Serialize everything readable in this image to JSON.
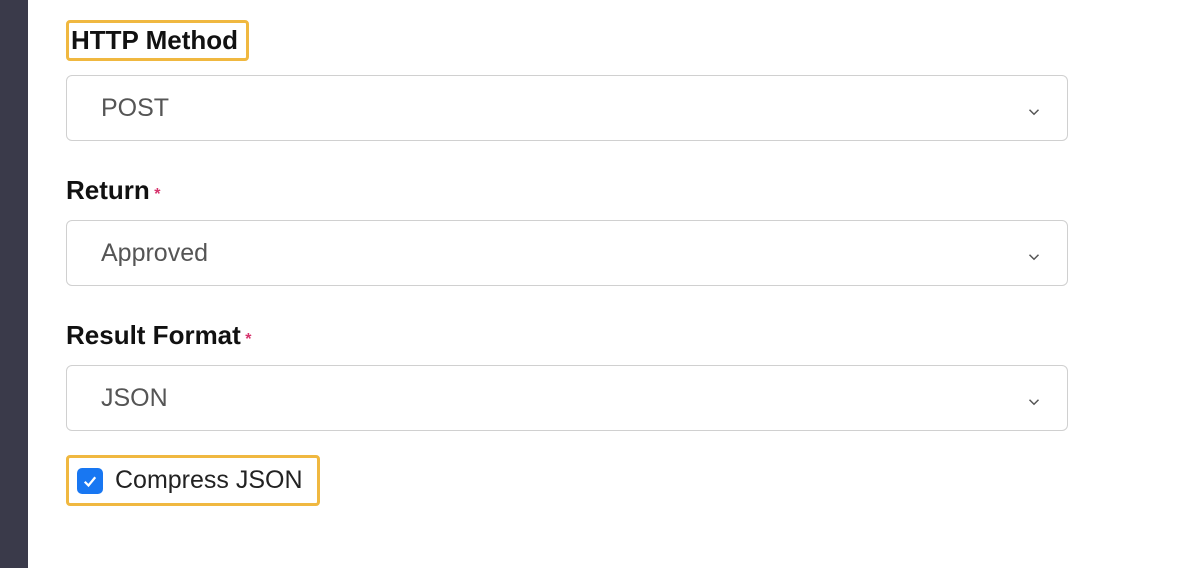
{
  "form": {
    "httpMethod": {
      "label": "HTTP Method",
      "value": "POST"
    },
    "return": {
      "label": "Return",
      "required": "*",
      "value": "Approved"
    },
    "resultFormat": {
      "label": "Result Format",
      "required": "*",
      "value": "JSON"
    },
    "compressJson": {
      "label": "Compress JSON",
      "checked": true
    }
  }
}
